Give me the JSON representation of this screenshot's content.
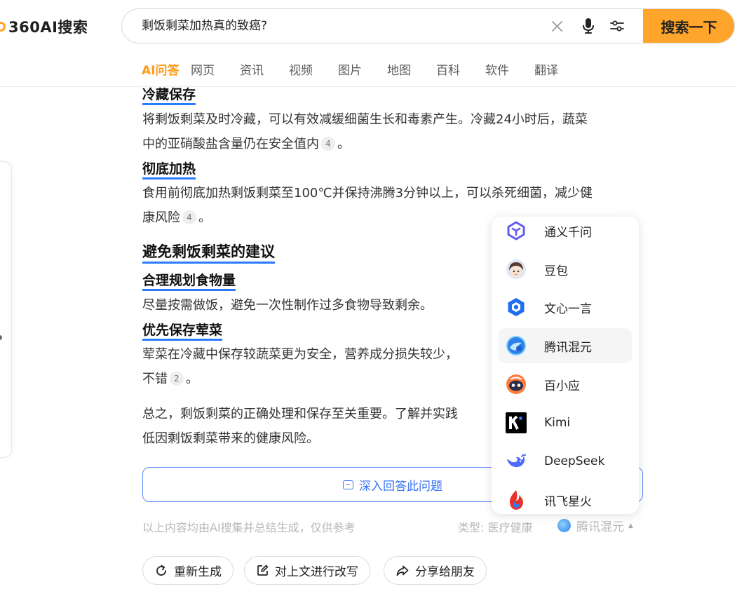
{
  "brand": {
    "logo_text": "360AI搜索",
    "accent": "#ffa52b",
    "link_blue": "#2b7bff"
  },
  "search": {
    "query": "剩饭剩菜加热真的致癌?",
    "button_label": "搜索一下"
  },
  "tabs": [
    {
      "label": "AI问答",
      "active": true
    },
    {
      "label": "网页"
    },
    {
      "label": "资讯"
    },
    {
      "label": "视频"
    },
    {
      "label": "图片"
    },
    {
      "label": "地图"
    },
    {
      "label": "百科"
    },
    {
      "label": "软件"
    },
    {
      "label": "翻译"
    }
  ],
  "answer": {
    "s1_heading": "冷藏保存",
    "s1_line1": "将剩饭剩菜及时冷藏，可以有效减缓细菌生长和毒素产生。冷藏24小时后，蔬菜",
    "s1_line2": "中的亚硝酸盐含量仍在安全值内",
    "s1_cite": "4",
    "s1_end": "。",
    "s2_heading": "彻底加热",
    "s2_line1": "食用前彻底加热剩饭剩菜至100℃并保持沸腾3分钟以上，可以杀死细菌，减少健",
    "s2_line2": "康风险",
    "s2_cite": "4",
    "s2_end": "。",
    "section_heading": "避免剩饭剩菜的建议",
    "s3_heading": "合理规划食物量",
    "s3_line1": "尽量按需做饭，避免一次性制作过多食物导致剩余。",
    "s4_heading": "优先保存荤菜",
    "s4_line1": "荤菜在冷藏中保存较蔬菜更为安全，营养成分损失较少，",
    "s4_line2": "不错",
    "s4_cite": "2",
    "s4_end": "。",
    "summary_line1": "总之，剩饭剩菜的正确处理和保存至关重要。了解并实践",
    "summary_line2": "低因剩饭剩菜带来的健康风险。"
  },
  "deep_answer_label": "深入回答此问题",
  "footer": {
    "note": "以上内容均由AI搜集并总结生成，仅供参考",
    "type_label": "类型:",
    "type_value": "医疗健康",
    "model": "腾讯混元"
  },
  "actions": {
    "regenerate": "重新生成",
    "rewrite": "对上文进行改写",
    "share": "分享给朋友"
  },
  "models": [
    {
      "label": "通义千问",
      "icon": "tongyi-icon"
    },
    {
      "label": "豆包",
      "icon": "doubao-icon"
    },
    {
      "label": "文心一言",
      "icon": "wenxin-icon"
    },
    {
      "label": "腾讯混元",
      "icon": "hunyuan-icon",
      "hovered": true
    },
    {
      "label": "百小应",
      "icon": "baixiaoying-icon"
    },
    {
      "label": "Kimi",
      "icon": "kimi-icon"
    },
    {
      "label": "DeepSeek",
      "icon": "deepseek-icon"
    },
    {
      "label": "讯飞星火",
      "icon": "xinghuo-icon"
    }
  ]
}
